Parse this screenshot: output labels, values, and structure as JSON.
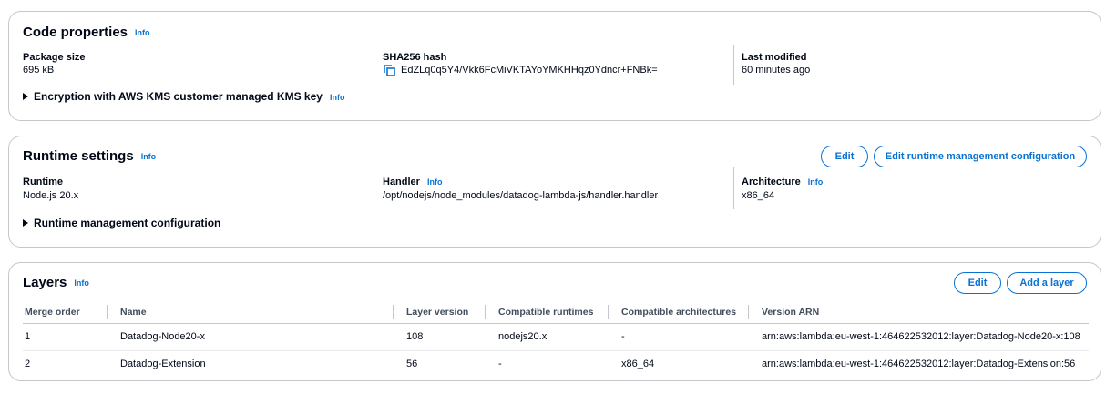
{
  "code_properties": {
    "title": "Code properties",
    "info": "Info",
    "package_size_label": "Package size",
    "package_size_value": "695 kB",
    "sha_label": "SHA256 hash",
    "sha_value": "EdZLq0q5Y4/Vkk6FcMiVKTAYoYMKHHqz0Ydncr+FNBk=",
    "last_modified_label": "Last modified",
    "last_modified_value": "60 minutes ago",
    "encryption_label": "Encryption with AWS KMS customer managed KMS key",
    "encryption_info": "Info"
  },
  "runtime_settings": {
    "title": "Runtime settings",
    "info": "Info",
    "edit_label": "Edit",
    "edit_runtime_mgmt_label": "Edit runtime management configuration",
    "runtime_label": "Runtime",
    "runtime_value": "Node.js 20.x",
    "handler_label": "Handler",
    "handler_info": "Info",
    "handler_value": "/opt/nodejs/node_modules/datadog-lambda-js/handler.handler",
    "architecture_label": "Architecture",
    "architecture_info": "Info",
    "architecture_value": "x86_64",
    "runtime_mgmt_label": "Runtime management configuration"
  },
  "layers": {
    "title": "Layers",
    "info": "Info",
    "edit_label": "Edit",
    "add_layer_label": "Add a layer",
    "columns": [
      "Merge order",
      "Name",
      "Layer version",
      "Compatible runtimes",
      "Compatible architectures",
      "Version ARN"
    ],
    "rows": [
      [
        "1",
        "Datadog-Node20-x",
        "108",
        "nodejs20.x",
        "-",
        "arn:aws:lambda:eu-west-1:464622532012:layer:Datadog-Node20-x:108"
      ],
      [
        "2",
        "Datadog-Extension",
        "56",
        "-",
        "x86_64",
        "arn:aws:lambda:eu-west-1:464622532012:layer:Datadog-Extension:56"
      ]
    ]
  },
  "colors": {
    "accent": "#0972d3",
    "border": "#c6c6cd",
    "text": "#000716"
  }
}
